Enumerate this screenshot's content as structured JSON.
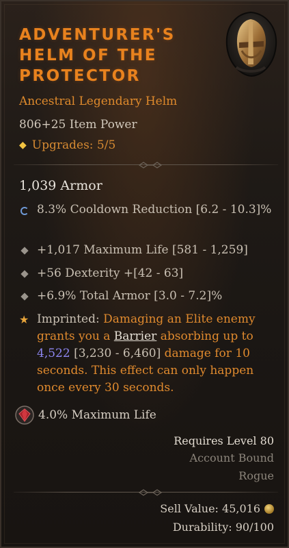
{
  "item": {
    "name": "Adventurer's Helm of the Protector",
    "type": "Ancestral Legendary Helm",
    "item_power": "806+25 Item Power",
    "upgrades": "Upgrades: 5/5",
    "armor": "1,039 Armor"
  },
  "affixes": [
    {
      "text": "8.3% Cooldown Reduction [6.2 - 10.3]%",
      "bullet": "ring-icon"
    },
    {
      "text": "+1,017 Maximum Life [581 - 1,259]",
      "bullet": "diamond-icon"
    },
    {
      "text": "+56 Dexterity +[42 - 63]",
      "bullet": "diamond-icon"
    },
    {
      "text": "+6.9% Total Armor [3.0 - 7.2]%",
      "bullet": "diamond-icon"
    }
  ],
  "imprint": {
    "label": "Imprinted:",
    "part1": "Damaging an Elite enemy grants you a",
    "keyword": "Barrier",
    "part2": "absorbing up to",
    "value": "4,522",
    "range": "[3,230 - 6,460]",
    "part3": "damage for 10 seconds. This effect can only happen once every 30 seconds."
  },
  "aspect": {
    "text": "4.0% Maximum Life",
    "icon": "gem-icon"
  },
  "requirements": {
    "level": "Requires Level 80",
    "bound": "Account Bound",
    "class": "Rogue"
  },
  "footer": {
    "sell_value": "Sell Value: 45,016",
    "durability": "Durability: 90/100"
  },
  "colors": {
    "legendary": "#e8821e",
    "text": "#c9c0b3",
    "accent_blue": "#8d86f0"
  }
}
